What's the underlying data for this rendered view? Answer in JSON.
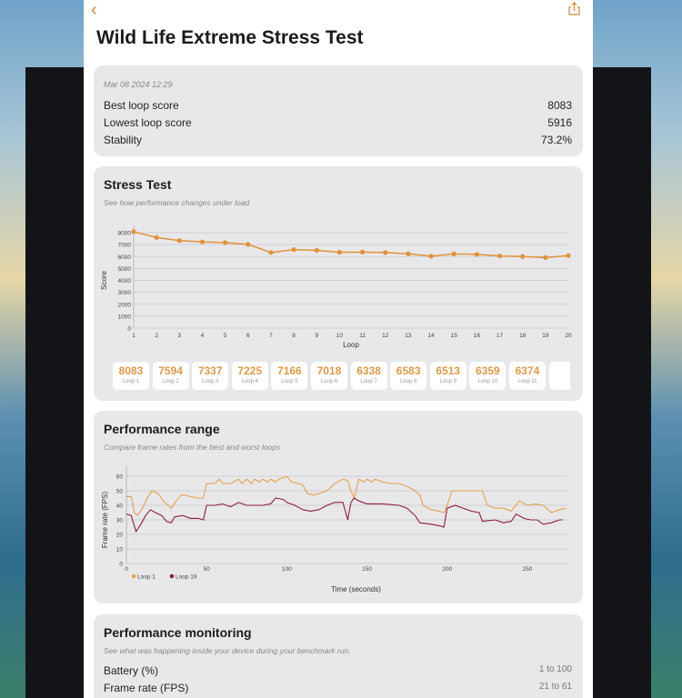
{
  "header": {
    "back_icon": "chevron-left-icon",
    "share_icon": "share-icon",
    "title": "Wild Life Extreme Stress Test"
  },
  "summary": {
    "date": "Mar 08 2024 12:29",
    "rows": [
      {
        "label": "Best loop score",
        "value": "8083"
      },
      {
        "label": "Lowest loop score",
        "value": "5916"
      },
      {
        "label": "Stability",
        "value": "73.2%"
      }
    ]
  },
  "colors": {
    "accent": "#e0913a",
    "loop1": "#e8a04e",
    "loop19": "#8e1f3e"
  },
  "chart_data": [
    {
      "type": "line",
      "title": "Stress Test",
      "subtitle": "See how performance changes under load",
      "xlabel": "Loop",
      "ylabel": "Score",
      "ylim": [
        0,
        8000
      ],
      "yticks": [
        0,
        1000,
        2000,
        3000,
        4000,
        5000,
        6000,
        7000,
        8000
      ],
      "x": [
        1,
        2,
        3,
        4,
        5,
        6,
        7,
        8,
        9,
        10,
        11,
        12,
        13,
        14,
        15,
        16,
        17,
        18,
        19,
        20
      ],
      "values": [
        8083,
        7594,
        7337,
        7225,
        7166,
        7018,
        6338,
        6583,
        6513,
        6359,
        6374,
        6330,
        6230,
        6030,
        6220,
        6180,
        6050,
        6000,
        5916,
        6080
      ],
      "grid": true
    },
    {
      "type": "line",
      "title": "Performance range",
      "subtitle": "Compare frame rates from the best and worst loops",
      "xlabel": "Time (seconds)",
      "ylabel": "Frame rate (FPS)",
      "xlim": [
        0,
        275
      ],
      "ylim": [
        0,
        65
      ],
      "xticks": [
        0,
        50,
        100,
        150,
        200,
        250
      ],
      "yticks": [
        0,
        10,
        20,
        30,
        40,
        50,
        60
      ],
      "grid": true,
      "legend": "bottom-left",
      "series": [
        {
          "name": "Loop 1",
          "points": [
            [
              0,
              46
            ],
            [
              3,
              46
            ],
            [
              5,
              35
            ],
            [
              7,
              33
            ],
            [
              10,
              38
            ],
            [
              13,
              45
            ],
            [
              16,
              50
            ],
            [
              20,
              48
            ],
            [
              23,
              43
            ],
            [
              26,
              40
            ],
            [
              28,
              38
            ],
            [
              31,
              43
            ],
            [
              34,
              47
            ],
            [
              37,
              47
            ],
            [
              40,
              46
            ],
            [
              45,
              45
            ],
            [
              48,
              45
            ],
            [
              50,
              55
            ],
            [
              55,
              55
            ],
            [
              58,
              58
            ],
            [
              60,
              55
            ],
            [
              65,
              55
            ],
            [
              70,
              58
            ],
            [
              72,
              55
            ],
            [
              75,
              58
            ],
            [
              78,
              55
            ],
            [
              80,
              58
            ],
            [
              83,
              56
            ],
            [
              85,
              58
            ],
            [
              88,
              56
            ],
            [
              90,
              58
            ],
            [
              93,
              56
            ],
            [
              95,
              58
            ],
            [
              100,
              60
            ],
            [
              103,
              56
            ],
            [
              107,
              55
            ],
            [
              110,
              54
            ],
            [
              113,
              48
            ],
            [
              117,
              47
            ],
            [
              120,
              48
            ],
            [
              125,
              50
            ],
            [
              130,
              55
            ],
            [
              135,
              58
            ],
            [
              138,
              57
            ],
            [
              140,
              50
            ],
            [
              142,
              45
            ],
            [
              145,
              58
            ],
            [
              148,
              56
            ],
            [
              150,
              58
            ],
            [
              153,
              56
            ],
            [
              155,
              58
            ],
            [
              160,
              56
            ],
            [
              165,
              55
            ],
            [
              170,
              55
            ],
            [
              175,
              53
            ],
            [
              180,
              50
            ],
            [
              183,
              47
            ],
            [
              185,
              40
            ],
            [
              190,
              37
            ],
            [
              195,
              36
            ],
            [
              198,
              35
            ],
            [
              200,
              40
            ],
            [
              203,
              50
            ],
            [
              210,
              50
            ],
            [
              215,
              50
            ],
            [
              222,
              50
            ],
            [
              225,
              40
            ],
            [
              230,
              38
            ],
            [
              235,
              38
            ],
            [
              240,
              36
            ],
            [
              245,
              43
            ],
            [
              250,
              40
            ],
            [
              255,
              41
            ],
            [
              260,
              40
            ],
            [
              265,
              35
            ],
            [
              270,
              37
            ],
            [
              274,
              38
            ]
          ]
        },
        {
          "name": "Loop 19",
          "points": [
            [
              0,
              34
            ],
            [
              3,
              33
            ],
            [
              6,
              22
            ],
            [
              9,
              27
            ],
            [
              12,
              33
            ],
            [
              15,
              37
            ],
            [
              18,
              35
            ],
            [
              22,
              33
            ],
            [
              25,
              29
            ],
            [
              28,
              28
            ],
            [
              30,
              32
            ],
            [
              35,
              33
            ],
            [
              40,
              31
            ],
            [
              45,
              31
            ],
            [
              48,
              30
            ],
            [
              50,
              40
            ],
            [
              55,
              40
            ],
            [
              60,
              41
            ],
            [
              65,
              39
            ],
            [
              70,
              42
            ],
            [
              75,
              40
            ],
            [
              80,
              40
            ],
            [
              85,
              40
            ],
            [
              90,
              41
            ],
            [
              93,
              45
            ],
            [
              98,
              44
            ],
            [
              100,
              42
            ],
            [
              105,
              40
            ],
            [
              110,
              37
            ],
            [
              115,
              36
            ],
            [
              120,
              37
            ],
            [
              125,
              40
            ],
            [
              130,
              42
            ],
            [
              135,
              42
            ],
            [
              138,
              30
            ],
            [
              140,
              42
            ],
            [
              142,
              45
            ],
            [
              145,
              43
            ],
            [
              150,
              41
            ],
            [
              160,
              41
            ],
            [
              170,
              40
            ],
            [
              175,
              38
            ],
            [
              180,
              33
            ],
            [
              183,
              28
            ],
            [
              190,
              27
            ],
            [
              195,
              26
            ],
            [
              198,
              25
            ],
            [
              200,
              38
            ],
            [
              205,
              40
            ],
            [
              210,
              38
            ],
            [
              215,
              36
            ],
            [
              220,
              35
            ],
            [
              222,
              29
            ],
            [
              230,
              30
            ],
            [
              235,
              28
            ],
            [
              240,
              29
            ],
            [
              243,
              34
            ],
            [
              248,
              31
            ],
            [
              252,
              30
            ],
            [
              256,
              30
            ],
            [
              260,
              27
            ],
            [
              265,
              28
            ],
            [
              270,
              30
            ],
            [
              272,
              30
            ]
          ]
        }
      ]
    }
  ],
  "loop_tiles": [
    {
      "value": "8083",
      "label": "Loop 1"
    },
    {
      "value": "7594",
      "label": "Loop 2"
    },
    {
      "value": "7337",
      "label": "Loop 3"
    },
    {
      "value": "7225",
      "label": "Loop 4"
    },
    {
      "value": "7166",
      "label": "Loop 5"
    },
    {
      "value": "7018",
      "label": "Loop 6"
    },
    {
      "value": "6338",
      "label": "Loop 7"
    },
    {
      "value": "6583",
      "label": "Loop 8"
    },
    {
      "value": "6513",
      "label": "Loop 9"
    },
    {
      "value": "6359",
      "label": "Loop 10"
    },
    {
      "value": "6374",
      "label": "Loop 11"
    },
    {
      "value": "",
      "label": ""
    }
  ],
  "monitoring": {
    "title": "Performance monitoring",
    "subtitle": "See what was happening inside your device during your benchmark run.",
    "rows": [
      {
        "label": "Battery (%)",
        "value": "1 to 100"
      },
      {
        "label": "Frame rate (FPS)",
        "value": "21 to 61"
      }
    ]
  }
}
